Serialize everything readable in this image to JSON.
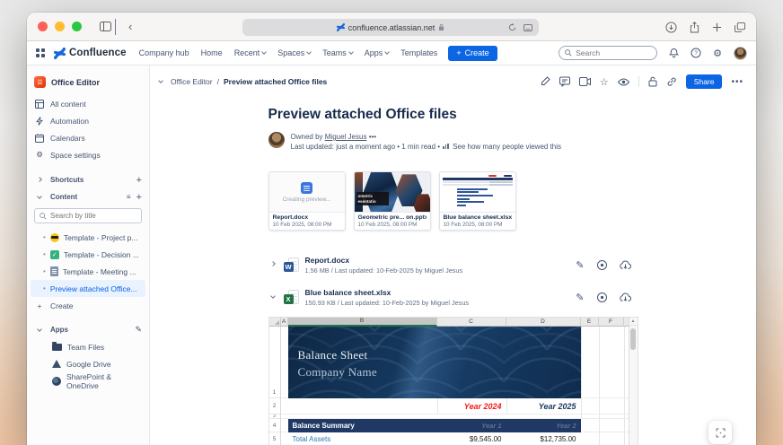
{
  "browser": {
    "url": "confluence.atlassian.net"
  },
  "topnav": {
    "brand": "Confluence",
    "items": [
      {
        "label": "Company hub"
      },
      {
        "label": "Home"
      },
      {
        "label": "Recent"
      },
      {
        "label": "Spaces"
      },
      {
        "label": "Teams"
      },
      {
        "label": "Apps"
      },
      {
        "label": "Templates"
      }
    ],
    "create_label": "Create",
    "search_placeholder": "Search"
  },
  "sidebar": {
    "space_name": "Office Editor",
    "items": [
      {
        "label": "All content"
      },
      {
        "label": "Automation"
      },
      {
        "label": "Calendars"
      },
      {
        "label": "Space settings"
      }
    ],
    "shortcuts_label": "Shortcuts",
    "content_label": "Content",
    "search_placeholder": "Search by title",
    "pages": [
      {
        "label": "Template - Project p..."
      },
      {
        "label": "Template - Decision ..."
      },
      {
        "label": "Template - Meeting ..."
      },
      {
        "label": "Preview attached Office..."
      }
    ],
    "create_label": "Create",
    "apps_label": "Apps",
    "apps": [
      {
        "label": "Team Files"
      },
      {
        "label": "Google Drive"
      },
      {
        "label": "SharePoint & OneDrive"
      }
    ]
  },
  "page": {
    "breadcrumb_space": "Office Editor",
    "breadcrumb_page": "Preview attached Office files",
    "title": "Preview attached Office files",
    "owned_by": "Owned by",
    "owner": "Miguel Jesus",
    "owner_more": "•••",
    "meta_line": "Last updated: just a moment ago  •  1 min read  •",
    "views_link": "See how many people viewed this",
    "share_label": "Share",
    "cards": [
      {
        "name": "Report.docx",
        "date": "10 Feb 2025, 08:00 PM",
        "placeholder": "Creating preview..."
      },
      {
        "name": "Geometric pre... on.pptx",
        "date": "10 Feb 2025, 08:00 PM",
        "thumb_line1": "ometric",
        "thumb_line2": "esentatio"
      },
      {
        "name": "Blue balance sheet.xlsx",
        "date": "10 Feb 2025, 08:00 PM"
      }
    ],
    "files": [
      {
        "name": "Report.docx",
        "meta": "1.56 MB / Last updated: 10-Feb-2025 by Miguel Jesus",
        "type_letter": "W"
      },
      {
        "name": "Blue balance sheet.xlsx",
        "meta": "150.93 KB / Last updated: 10-Feb-2025 by Miguel Jesus",
        "type_letter": "X"
      }
    ]
  },
  "sheet": {
    "columns": [
      "A",
      "B",
      "C",
      "D",
      "E",
      "F"
    ],
    "rows": [
      "1",
      "2",
      "3",
      "4",
      "5"
    ],
    "banner_title": "Balance Sheet",
    "banner_subtitle": "Company Name",
    "year_left": "Year 2024",
    "year_right": "Year 2025",
    "summary_header": "Balance Summary",
    "ghost_year_1": "Year 1",
    "ghost_year_2": "Year 2",
    "data_rows": [
      {
        "label": "Total Assets",
        "year_2024": "$9,545.00",
        "year_2025": "$12,735.00"
      }
    ]
  },
  "colors": {
    "accent_blue": "#0C66E4",
    "word_blue": "#2B579A",
    "excel_green": "#217346",
    "banner_navy": "#132F51",
    "summary_navy": "#1F3864",
    "year_red": "#EF1C18",
    "year_navy": "#17375E",
    "link_blue": "#2E75B6",
    "selected_item_bg": "#E9F2FF",
    "space_icon_orange": "#DE350B"
  }
}
